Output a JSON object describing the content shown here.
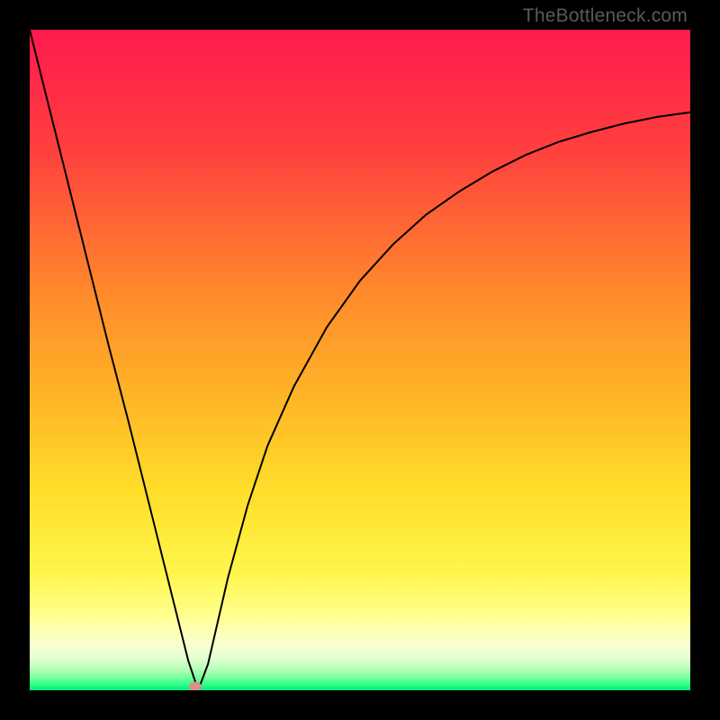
{
  "watermark": "TheBottleneck.com",
  "chart_data": {
    "type": "line",
    "title": "",
    "xlabel": "",
    "ylabel": "",
    "xlim": [
      0,
      100
    ],
    "ylim": [
      0,
      100
    ],
    "gradient_stops": [
      {
        "t": 0.0,
        "color": "#ff1a4d"
      },
      {
        "t": 0.18,
        "color": "#ff3f3f"
      },
      {
        "t": 0.4,
        "color": "#ff8a2b"
      },
      {
        "t": 0.55,
        "color": "#ffb327"
      },
      {
        "t": 0.7,
        "color": "#ffde2a"
      },
      {
        "t": 0.82,
        "color": "#fff54a"
      },
      {
        "t": 0.885,
        "color": "#ffff8c"
      },
      {
        "t": 0.905,
        "color": "#ffffb0"
      },
      {
        "t": 0.928,
        "color": "#faffcc"
      },
      {
        "t": 0.948,
        "color": "#e6ffd2"
      },
      {
        "t": 0.965,
        "color": "#c2ffbe"
      },
      {
        "t": 0.98,
        "color": "#7dff9e"
      },
      {
        "t": 0.992,
        "color": "#2cff87"
      },
      {
        "t": 1.0,
        "color": "#00e87a"
      }
    ],
    "series": [
      {
        "name": "bottleneck-curve",
        "x": [
          0,
          3,
          6,
          9,
          12,
          15,
          18,
          21,
          24,
          25.5,
          27,
          30,
          33,
          36,
          40,
          45,
          50,
          55,
          60,
          65,
          70,
          75,
          80,
          85,
          90,
          95,
          100
        ],
        "y": [
          100,
          88,
          76,
          64,
          52,
          40.5,
          28.5,
          16.5,
          4.5,
          0,
          4,
          17,
          28,
          37,
          46,
          55,
          62,
          67.5,
          72,
          75.5,
          78.5,
          81,
          83,
          84.5,
          85.8,
          86.8,
          87.5
        ]
      }
    ],
    "marker": {
      "x": 25.0,
      "y": 0.5,
      "color": "#d98f8a"
    }
  }
}
